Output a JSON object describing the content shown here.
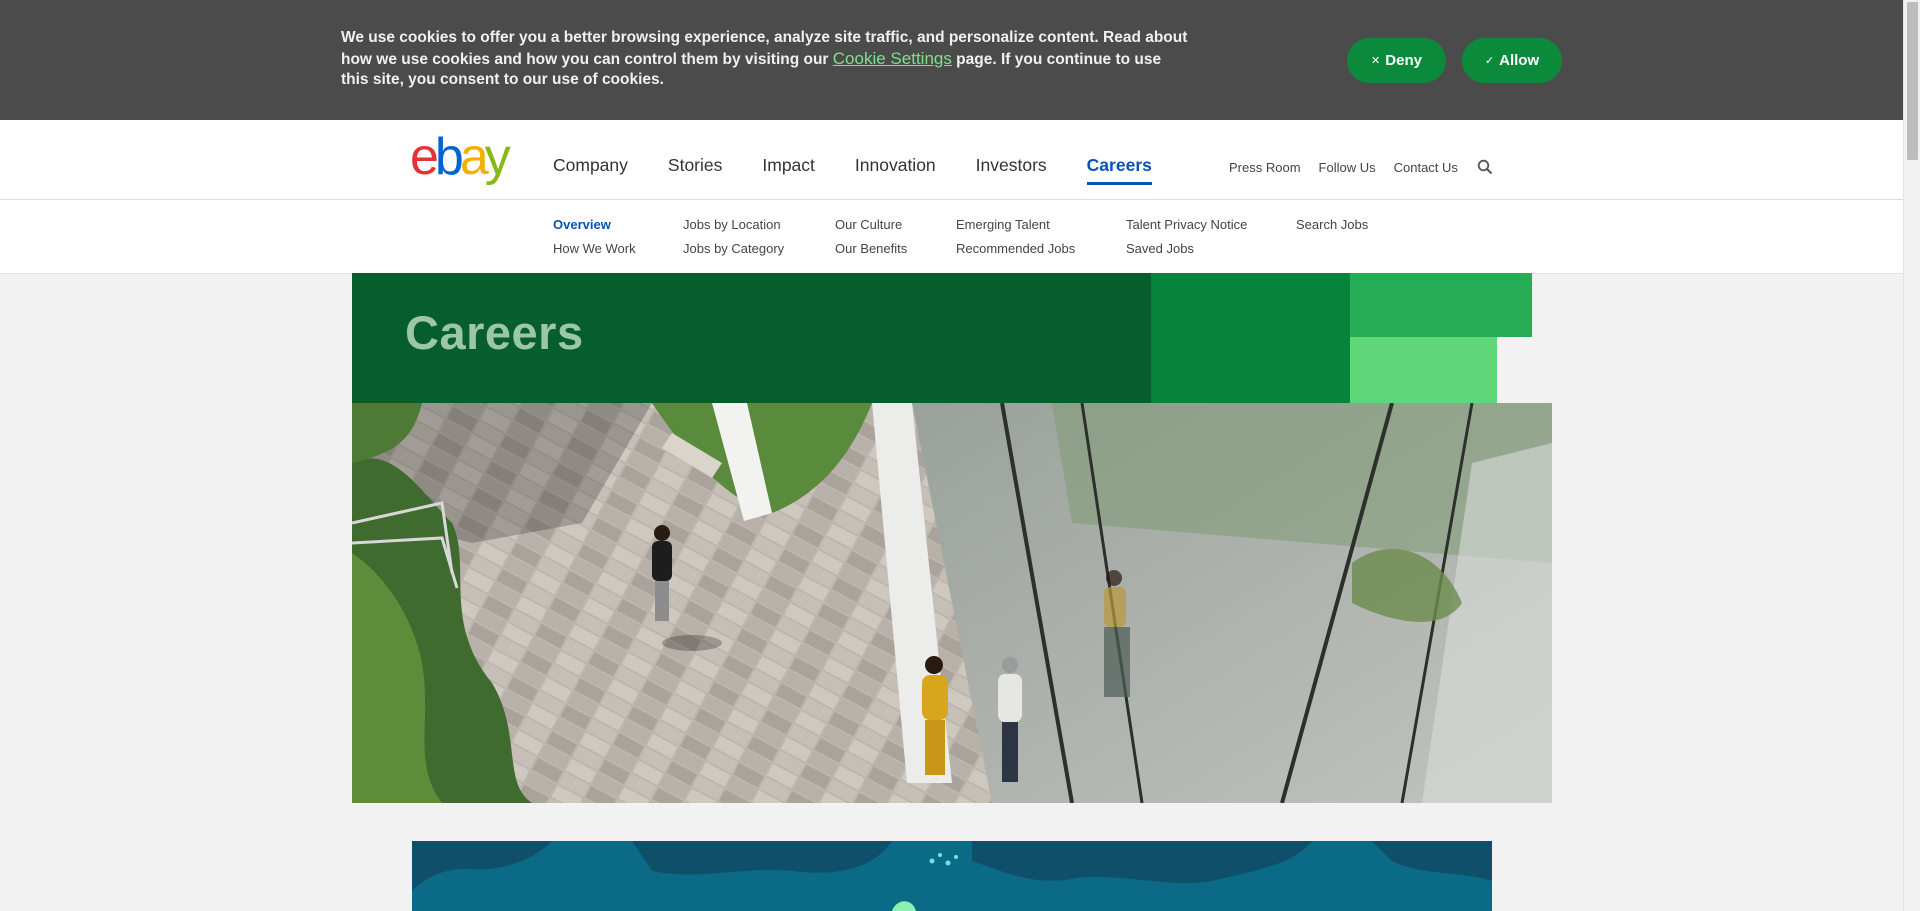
{
  "cookie_banner": {
    "text_before": "We use cookies to offer you a better browsing experience, analyze site traffic, and personalize content. Read about how we use cookies and how you can control them by visiting our ",
    "link_text": "Cookie Settings",
    "text_after": " page. If you continue to use this site, you consent to our use of cookies.",
    "deny_label": "Deny",
    "allow_label": "Allow",
    "deny_icon": "close-icon",
    "allow_icon": "checkmark-icon"
  },
  "header": {
    "logo_letters": [
      "e",
      "b",
      "a",
      "y"
    ],
    "logo_colors": [
      "#e53238",
      "#0064d2",
      "#f5af02",
      "#86b817"
    ],
    "main_nav": [
      "Company",
      "Stories",
      "Impact",
      "Innovation",
      "Investors",
      "Careers"
    ],
    "active_nav": "Careers",
    "utility_nav": [
      "Press Room",
      "Follow Us",
      "Contact Us"
    ],
    "search_icon": "search-icon"
  },
  "subnav": {
    "col1": [
      "Overview",
      "How We Work"
    ],
    "col2": [
      "Jobs by Location",
      "Jobs by Category"
    ],
    "col3": [
      "Our Culture",
      "Our Benefits"
    ],
    "col4": [
      "Emerging Talent",
      "Recommended Jobs"
    ],
    "col5": [
      "Talent Privacy Notice",
      "Saved Jobs"
    ],
    "col6": [
      "Search Jobs"
    ],
    "active": "Overview"
  },
  "hero": {
    "title": "Careers"
  },
  "colors": {
    "brand_green_dark": "#075e2d",
    "brand_green": "#06843c",
    "brand_green_mid": "#26ad55",
    "brand_green_light": "#5fd778",
    "link_blue": "#0654ba",
    "banner_bg": "#4b4b4b"
  }
}
